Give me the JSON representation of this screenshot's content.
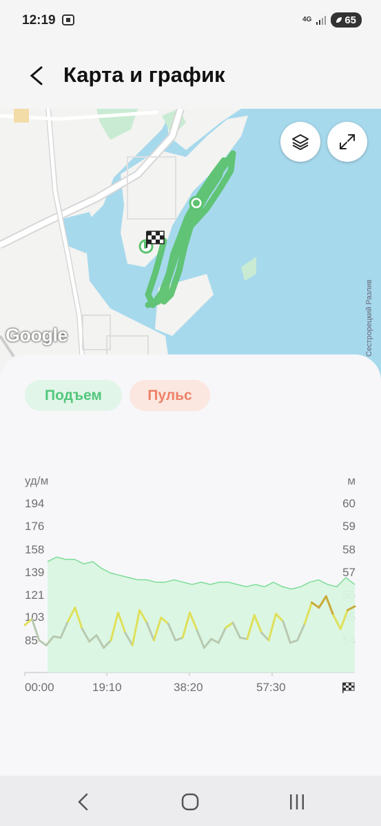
{
  "status": {
    "time": "12:19",
    "network": "4G",
    "battery": "65"
  },
  "header": {
    "title": "Карта и график"
  },
  "map": {
    "google_logo": "Google",
    "place_label": "Сестрорецкий Разлив",
    "layers_icon": "layers-icon",
    "expand_icon": "expand-icon"
  },
  "tabs": [
    {
      "label": "Подъем",
      "color": "#52c77c"
    },
    {
      "label": "Пульс",
      "color": "#ee8066"
    }
  ],
  "chart_data": {
    "type": "area",
    "left_axis": {
      "unit": "уд/м",
      "ticks": [
        "194",
        "176",
        "158",
        "139",
        "121",
        "103",
        "85"
      ]
    },
    "right_axis": {
      "unit": "м",
      "ticks": [
        "60",
        "59",
        "58",
        "57",
        "56",
        "55",
        "54"
      ]
    },
    "x_ticks": [
      "00:00",
      "19:10",
      "38:20",
      "57:30"
    ],
    "end_icon": "finish-flag-icon",
    "series": [
      {
        "name": "Подъем",
        "values": [
          57.5,
          57.7,
          57.6,
          57.6,
          57.4,
          57.5,
          57.2,
          57.0,
          56.9,
          56.8,
          56.7,
          56.7,
          56.6,
          56.6,
          56.7,
          56.6,
          56.5,
          56.6,
          56.5,
          56.6,
          56.6,
          56.5,
          56.4,
          56.5,
          56.4,
          56.6,
          56.4,
          56.3,
          56.4,
          56.6,
          56.7,
          56.5,
          56.4,
          56.8,
          56.5
        ]
      },
      {
        "name": "Пульс",
        "values": [
          98,
          103,
          86,
          82,
          89,
          88,
          101,
          112,
          95,
          85,
          90,
          80,
          86,
          108,
          92,
          82,
          110,
          100,
          86,
          104,
          99,
          86,
          88,
          108,
          94,
          80,
          87,
          84,
          96,
          100,
          88,
          87,
          106,
          92,
          86,
          107,
          101,
          84,
          86,
          99,
          116,
          112,
          121,
          106,
          95,
          110,
          113
        ]
      }
    ]
  },
  "nav": {
    "back": "back-nav-icon",
    "home": "home-nav-icon",
    "recents": "recents-nav-icon"
  }
}
